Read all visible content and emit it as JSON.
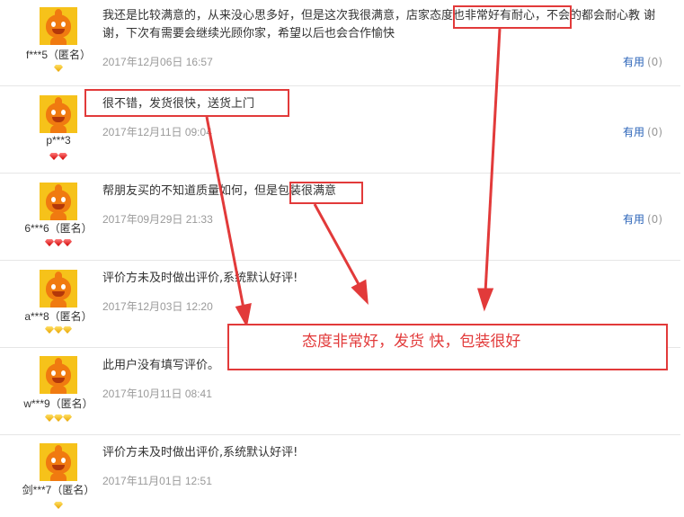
{
  "reviews": [
    {
      "username": "f***5（匿名）",
      "badge_type": "gold",
      "badge_count": 1,
      "content": "我还是比较满意的，从来没心思多好，但是这次我很满意，店家态度也非常好有耐心，不会的都会耐心教 谢谢，下次有需要会继续光顾你家，希望以后也会合作愉快",
      "date": "2017年12月06日 16:57",
      "useful_label": "有用",
      "useful_count": "(0)"
    },
    {
      "username": "p***3",
      "badge_type": "red",
      "badge_count": 2,
      "content": "很不错，发货很快，送货上门",
      "date": "2017年12月11日 09:04",
      "useful_label": "有用",
      "useful_count": "(0)"
    },
    {
      "username": "6***6（匿名）",
      "badge_type": "red",
      "badge_count": 3,
      "content": "帮朋友买的不知道质量如何，但是包装很满意",
      "date": "2017年09月29日 21:33",
      "useful_label": "有用",
      "useful_count": "(0)"
    },
    {
      "username": "a***8（匿名）",
      "badge_type": "gold",
      "badge_count": 3,
      "content": "评价方未及时做出评价,系统默认好评!",
      "date": "2017年12月03日 12:20",
      "useful_label": "",
      "useful_count": ""
    },
    {
      "username": "w***9（匿名）",
      "badge_type": "gold",
      "badge_count": 3,
      "content": "此用户没有填写评价。",
      "date": "2017年10月11日 08:41",
      "useful_label": "",
      "useful_count": ""
    },
    {
      "username": "剑***7（匿名）",
      "badge_type": "gold",
      "badge_count": 1,
      "content": "评价方未及时做出评价,系统默认好评!",
      "date": "2017年11月01日 12:51",
      "useful_label": "",
      "useful_count": ""
    }
  ],
  "annotation": {
    "summary_text": "态度非常好，发货 快，包装很好",
    "highlight_1": "态度也非常好有耐心",
    "highlight_2": "很不错，发货很快，送货上门",
    "highlight_3": "包装很满意"
  },
  "colors": {
    "annotation_red": "#e23a3a",
    "link_blue": "#2a63b8",
    "date_gray": "#9a9a9a",
    "avatar_orange": "#f07a10",
    "avatar_yellow": "#f6c21a"
  }
}
